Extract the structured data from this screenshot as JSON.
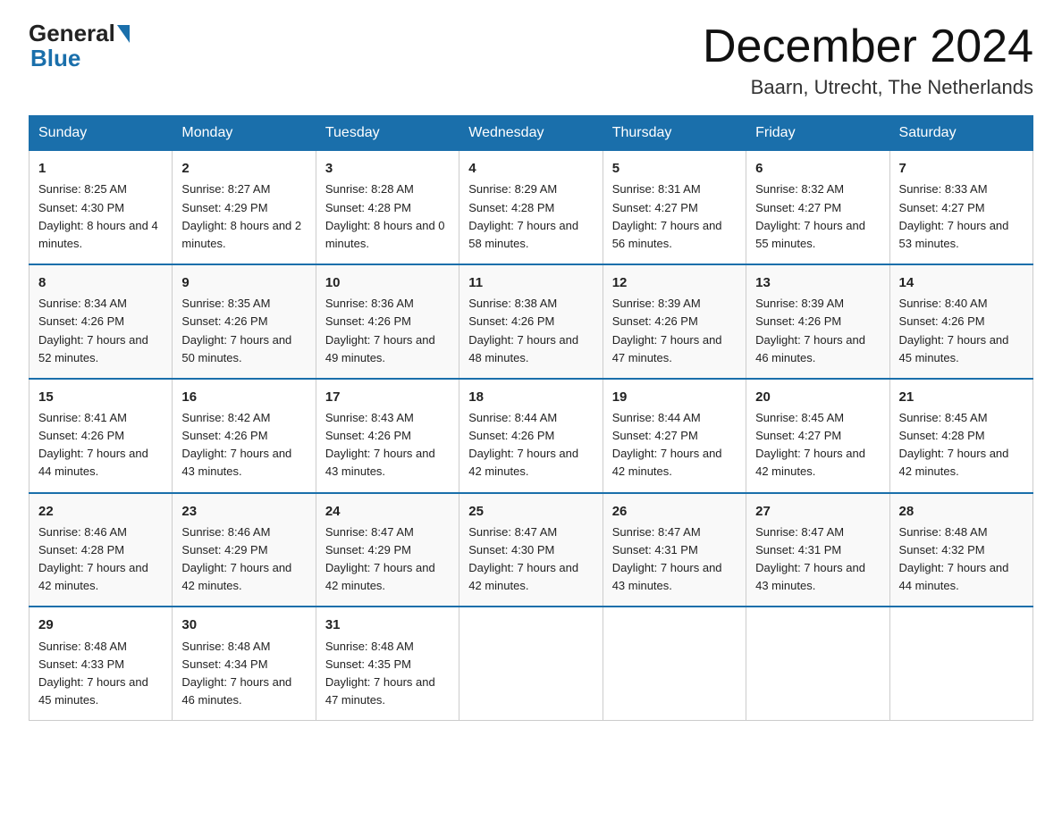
{
  "logo": {
    "general": "General",
    "blue": "Blue"
  },
  "title": "December 2024",
  "subtitle": "Baarn, Utrecht, The Netherlands",
  "days_of_week": [
    "Sunday",
    "Monday",
    "Tuesday",
    "Wednesday",
    "Thursday",
    "Friday",
    "Saturday"
  ],
  "weeks": [
    [
      {
        "day": "1",
        "sunrise": "8:25 AM",
        "sunset": "4:30 PM",
        "daylight": "8 hours and 4 minutes."
      },
      {
        "day": "2",
        "sunrise": "8:27 AM",
        "sunset": "4:29 PM",
        "daylight": "8 hours and 2 minutes."
      },
      {
        "day": "3",
        "sunrise": "8:28 AM",
        "sunset": "4:28 PM",
        "daylight": "8 hours and 0 minutes."
      },
      {
        "day": "4",
        "sunrise": "8:29 AM",
        "sunset": "4:28 PM",
        "daylight": "7 hours and 58 minutes."
      },
      {
        "day": "5",
        "sunrise": "8:31 AM",
        "sunset": "4:27 PM",
        "daylight": "7 hours and 56 minutes."
      },
      {
        "day": "6",
        "sunrise": "8:32 AM",
        "sunset": "4:27 PM",
        "daylight": "7 hours and 55 minutes."
      },
      {
        "day": "7",
        "sunrise": "8:33 AM",
        "sunset": "4:27 PM",
        "daylight": "7 hours and 53 minutes."
      }
    ],
    [
      {
        "day": "8",
        "sunrise": "8:34 AM",
        "sunset": "4:26 PM",
        "daylight": "7 hours and 52 minutes."
      },
      {
        "day": "9",
        "sunrise": "8:35 AM",
        "sunset": "4:26 PM",
        "daylight": "7 hours and 50 minutes."
      },
      {
        "day": "10",
        "sunrise": "8:36 AM",
        "sunset": "4:26 PM",
        "daylight": "7 hours and 49 minutes."
      },
      {
        "day": "11",
        "sunrise": "8:38 AM",
        "sunset": "4:26 PM",
        "daylight": "7 hours and 48 minutes."
      },
      {
        "day": "12",
        "sunrise": "8:39 AM",
        "sunset": "4:26 PM",
        "daylight": "7 hours and 47 minutes."
      },
      {
        "day": "13",
        "sunrise": "8:39 AM",
        "sunset": "4:26 PM",
        "daylight": "7 hours and 46 minutes."
      },
      {
        "day": "14",
        "sunrise": "8:40 AM",
        "sunset": "4:26 PM",
        "daylight": "7 hours and 45 minutes."
      }
    ],
    [
      {
        "day": "15",
        "sunrise": "8:41 AM",
        "sunset": "4:26 PM",
        "daylight": "7 hours and 44 minutes."
      },
      {
        "day": "16",
        "sunrise": "8:42 AM",
        "sunset": "4:26 PM",
        "daylight": "7 hours and 43 minutes."
      },
      {
        "day": "17",
        "sunrise": "8:43 AM",
        "sunset": "4:26 PM",
        "daylight": "7 hours and 43 minutes."
      },
      {
        "day": "18",
        "sunrise": "8:44 AM",
        "sunset": "4:26 PM",
        "daylight": "7 hours and 42 minutes."
      },
      {
        "day": "19",
        "sunrise": "8:44 AM",
        "sunset": "4:27 PM",
        "daylight": "7 hours and 42 minutes."
      },
      {
        "day": "20",
        "sunrise": "8:45 AM",
        "sunset": "4:27 PM",
        "daylight": "7 hours and 42 minutes."
      },
      {
        "day": "21",
        "sunrise": "8:45 AM",
        "sunset": "4:28 PM",
        "daylight": "7 hours and 42 minutes."
      }
    ],
    [
      {
        "day": "22",
        "sunrise": "8:46 AM",
        "sunset": "4:28 PM",
        "daylight": "7 hours and 42 minutes."
      },
      {
        "day": "23",
        "sunrise": "8:46 AM",
        "sunset": "4:29 PM",
        "daylight": "7 hours and 42 minutes."
      },
      {
        "day": "24",
        "sunrise": "8:47 AM",
        "sunset": "4:29 PM",
        "daylight": "7 hours and 42 minutes."
      },
      {
        "day": "25",
        "sunrise": "8:47 AM",
        "sunset": "4:30 PM",
        "daylight": "7 hours and 42 minutes."
      },
      {
        "day": "26",
        "sunrise": "8:47 AM",
        "sunset": "4:31 PM",
        "daylight": "7 hours and 43 minutes."
      },
      {
        "day": "27",
        "sunrise": "8:47 AM",
        "sunset": "4:31 PM",
        "daylight": "7 hours and 43 minutes."
      },
      {
        "day": "28",
        "sunrise": "8:48 AM",
        "sunset": "4:32 PM",
        "daylight": "7 hours and 44 minutes."
      }
    ],
    [
      {
        "day": "29",
        "sunrise": "8:48 AM",
        "sunset": "4:33 PM",
        "daylight": "7 hours and 45 minutes."
      },
      {
        "day": "30",
        "sunrise": "8:48 AM",
        "sunset": "4:34 PM",
        "daylight": "7 hours and 46 minutes."
      },
      {
        "day": "31",
        "sunrise": "8:48 AM",
        "sunset": "4:35 PM",
        "daylight": "7 hours and 47 minutes."
      },
      null,
      null,
      null,
      null
    ]
  ],
  "labels": {
    "sunrise": "Sunrise:",
    "sunset": "Sunset:",
    "daylight": "Daylight:"
  }
}
